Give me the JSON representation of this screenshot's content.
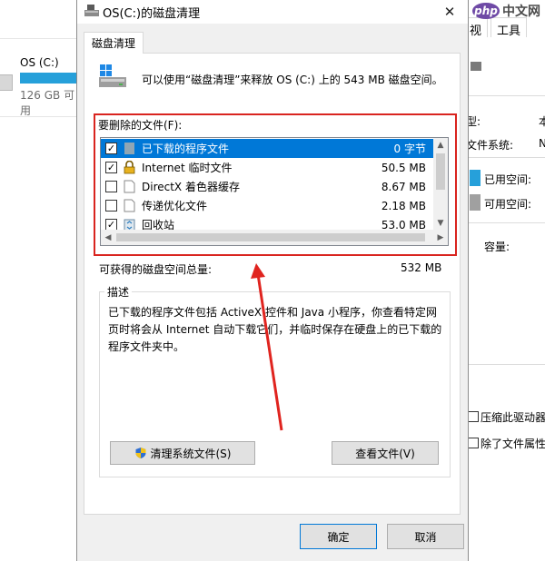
{
  "background_left": {
    "drive_name": "OS (C:)",
    "drive_size": "126 GB 可用",
    "usage_fraction": 1.0
  },
  "background_right": {
    "tab_partial": "视",
    "tab_tools": "工具",
    "type_label_partial": "型:",
    "type_value_partial": "本",
    "fs_label_partial": "文件系统:",
    "fs_value_partial": "N",
    "used_label": "已用空间:",
    "free_label": "可用空间:",
    "capacity_label": "容量:",
    "compress_label_partial": "压缩此驱动器",
    "index_label_partial": "除了文件属性外",
    "used_color": "#26a0da",
    "free_color": "#a0a0a0"
  },
  "watermark": {
    "logo": "php",
    "site": "中文网"
  },
  "dialog": {
    "title": "OS(C:)的磁盘清理",
    "close_glyph": "✕",
    "tab_label": "磁盘清理",
    "header_text": "可以使用“磁盘清理”来释放 OS (C:) 上的 543 MB 磁盘空间。",
    "files_label": "要删除的文件(F):",
    "files": [
      {
        "name": "已下载的程序文件",
        "size": "0 字节",
        "checked": true,
        "selected": true,
        "icon": "folder-icon"
      },
      {
        "name": "Internet 临时文件",
        "size": "50.5 MB",
        "checked": true,
        "selected": false,
        "icon": "lock-icon"
      },
      {
        "name": "DirectX 着色器缓存",
        "size": "8.67 MB",
        "checked": false,
        "selected": false,
        "icon": "file-icon"
      },
      {
        "name": "传递优化文件",
        "size": "2.18 MB",
        "checked": false,
        "selected": false,
        "icon": "file-icon"
      },
      {
        "name": "回收站",
        "size": "53.0 MB",
        "checked": true,
        "selected": false,
        "icon": "recycle-bin-icon"
      }
    ],
    "total_label": "可获得的磁盘空间总量:",
    "total_value": "532 MB",
    "desc_label": "描述",
    "desc_text": "已下载的程序文件包括 ActiveX 控件和 Java 小程序，你查看特定网页时将会从 Internet 自动下载它们，并临时保存在硬盘上的已下载的程序文件夹中。",
    "clean_system_button": "清理系统文件(S)",
    "view_files_button": "查看文件(V)",
    "ok_button": "确定",
    "cancel_button": "取消",
    "accent_color": "#0078d7",
    "highlight_color": "#d9241f"
  }
}
